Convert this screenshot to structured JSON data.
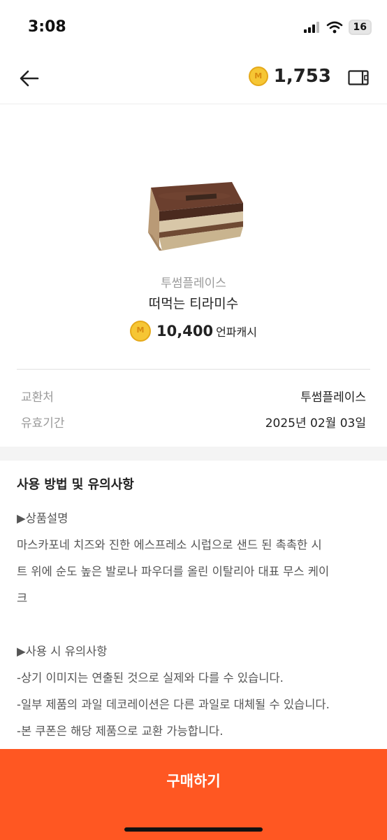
{
  "status": {
    "time": "3:08",
    "battery": "16"
  },
  "header": {
    "cash_balance": "1,753"
  },
  "product": {
    "brand": "투썸플레이스",
    "name": "떠먹는 티라미수",
    "price": "10,400",
    "price_unit": "언파캐시"
  },
  "info": [
    {
      "label": "교환처",
      "value": "투썸플레이스"
    },
    {
      "label": "유효기간",
      "value": "2025년 02월 03일"
    }
  ],
  "notes": {
    "title": "사용 방법 및 유의사항",
    "lines": [
      "▶상품설명",
      "마스카포네 치즈와 진한 에스프레소 시럽으로 샌드 된 촉촉한 시",
      "트 위에 순도 높은 발로나 파우더를 올린 이탈리아 대표 무스 케이",
      "크",
      "",
      "▶사용 시 유의사항",
      "-상기 이미지는 연출된 것으로 실제와 다를 수 있습니다.",
      "-일부 제품의 과일 데코레이션은 다른 과일로 대체될 수 있습니다.",
      "-본 쿠폰은 해당 제품으로 교환 가능합니다."
    ]
  },
  "buy_button": {
    "label": "구매하기"
  },
  "colors": {
    "accent": "#ff5722",
    "coin": "#f6c634"
  },
  "icons": [
    "back-arrow-icon",
    "coin-icon",
    "wallet-icon",
    "signal-icon",
    "wifi-icon",
    "battery-icon"
  ]
}
